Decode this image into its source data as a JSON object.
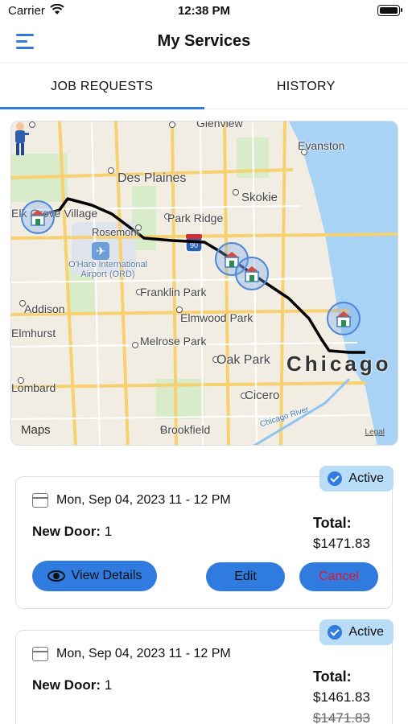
{
  "status_bar": {
    "carrier": "Carrier",
    "time": "12:38 PM"
  },
  "header": {
    "title": "My Services",
    "menu_icon": "hamburger-menu-icon"
  },
  "tabs": [
    {
      "label": "JOB REQUESTS",
      "active": true
    },
    {
      "label": "HISTORY",
      "active": false
    }
  ],
  "map": {
    "places": [
      "Glenview",
      "Evanston",
      "Des Plaines",
      "Skokie",
      "Elk Grove Village",
      "Rosemont",
      "Park Ridge",
      "O'Hare International Airport (ORD)",
      "Franklin Park",
      "Addison",
      "Elmwood Park",
      "Elmhurst",
      "Melrose Park",
      "Oak Park",
      "Chicago",
      "Lombard",
      "Cicero",
      "Brookfield",
      "Chicago River"
    ],
    "highway": "90",
    "brand": "Maps",
    "legal": "Legal"
  },
  "jobs": [
    {
      "status": "Active",
      "date": "Mon, Sep 04, 2023 11 - 12 PM",
      "service_label": "New Door:",
      "service_qty": "1",
      "total_label": "Total:",
      "total": "$1471.83",
      "view_label": "View Details",
      "edit_label": "Edit",
      "cancel_label": "Cancel"
    },
    {
      "status": "Active",
      "date": "Mon, Sep 04, 2023 11 - 12 PM",
      "service_label": "New Door:",
      "service_qty": "1",
      "total_label": "Total:",
      "total": "$1461.83",
      "old_total": "$1471.83"
    }
  ],
  "colors": {
    "accent": "#2f7be0",
    "badge_bg": "#b9dcf7",
    "cancel": "#e0192a",
    "water": "#a9d3f5",
    "route": "#000000"
  }
}
